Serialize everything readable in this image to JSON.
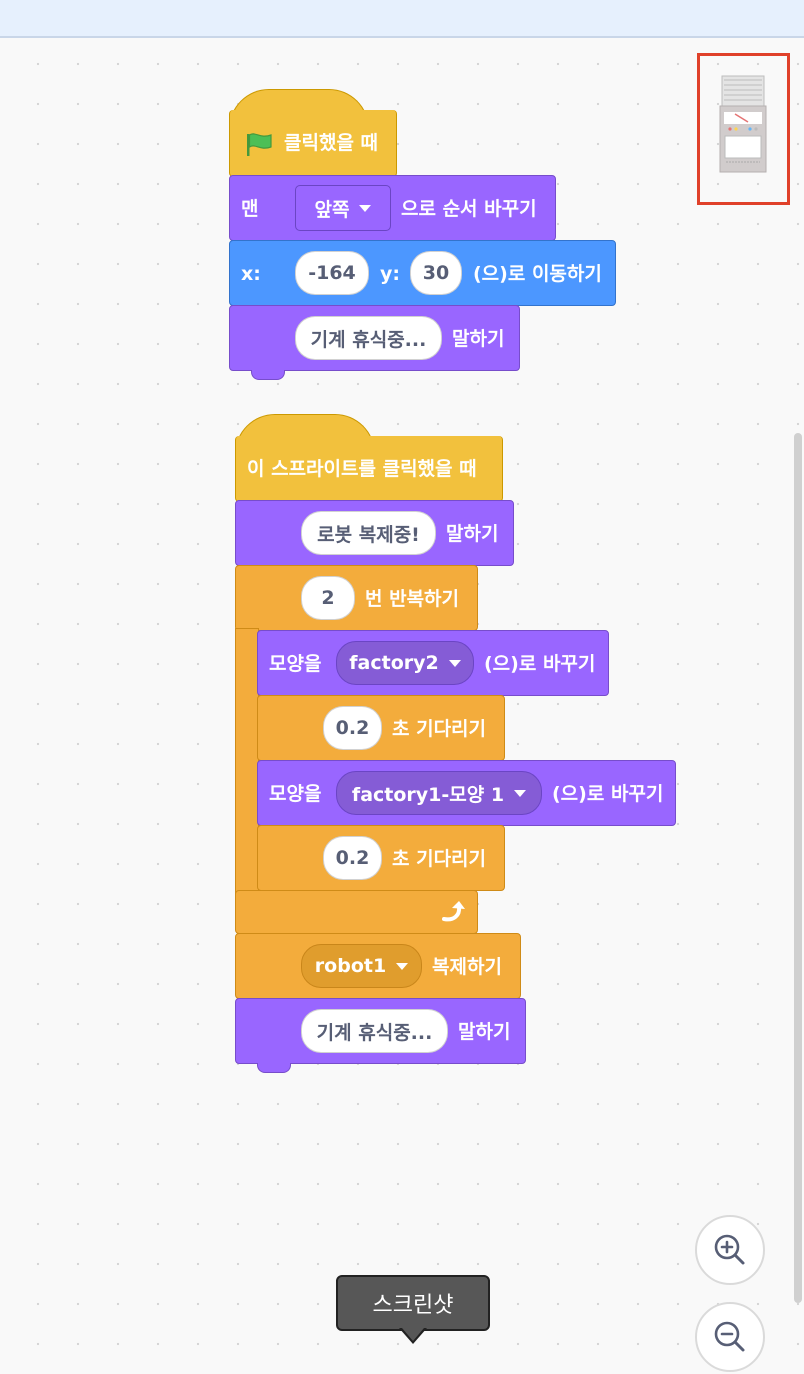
{
  "script1": {
    "hat_label": "클릭했을 때",
    "front_prefix": "맨",
    "front_option": "앞쪽",
    "front_suffix": "으로 순서 바꾸기",
    "x_label": "x:",
    "x_value": "-164",
    "y_label": "y:",
    "y_value": "30",
    "goto_suffix": "(으)로 이동하기",
    "say_text": "기계 휴식중...",
    "say_suffix": "말하기"
  },
  "script2": {
    "hat_label": "이 스프라이트를 클릭했을 때",
    "say_text": "로봇 복제중!",
    "say_suffix": "말하기",
    "repeat_count": "2",
    "repeat_suffix": "번 반복하기",
    "costume_prefix": "모양을",
    "costume1": "factory2",
    "costume_suffix": "(으)로 바꾸기",
    "wait1": "0.2",
    "wait_suffix": "초 기다리기",
    "costume2": "factory1-모양 1",
    "wait2": "0.2",
    "clone_target": "robot1",
    "clone_suffix": "복제하기",
    "say2_text": "기계 휴식중...",
    "say2_suffix": "말하기"
  },
  "tooltip": {
    "text": "스크린샷"
  },
  "icons": {
    "flag": "green-flag-icon",
    "loop": "loop-arrow-icon",
    "zoom_in": "zoom-in-icon",
    "zoom_out": "zoom-out-icon"
  },
  "colors": {
    "events": "#f2c13d",
    "looks": "#9966ff",
    "motion": "#4c97ff",
    "control": "#f3ac3c",
    "highlight": "#e0412a"
  }
}
